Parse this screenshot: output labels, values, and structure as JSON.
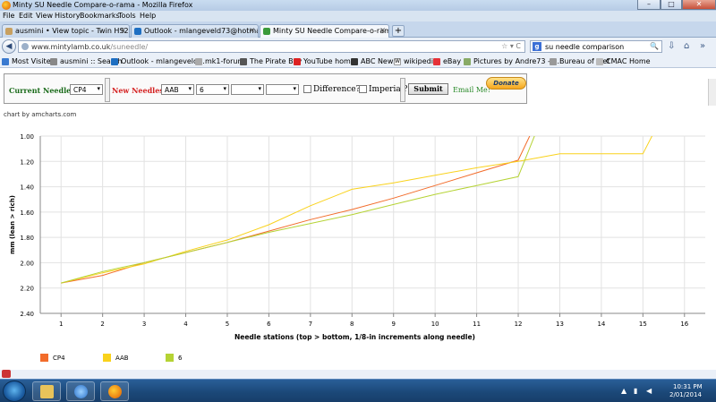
{
  "window": {
    "title": "Minty SU Needle Compare-o-rama - Mozilla Firefox",
    "minimize": "–",
    "maximize": "□",
    "close": "✕"
  },
  "menu": [
    "File",
    "Edit",
    "View",
    "History",
    "Bookmarks",
    "Tools",
    "Help"
  ],
  "tabs": [
    {
      "label": "ausmini • View topic - Twin HS2 1.5\" ...",
      "close": "×",
      "icon_color": "#c8a060"
    },
    {
      "label": "Outlook - mlangeveld73@hotmail.com",
      "close": "×",
      "icon_color": "#1e6fc2"
    },
    {
      "label": "Minty SU Needle Compare-o-rama",
      "close": "×",
      "icon_color": "#3a9a3a",
      "active": true
    }
  ],
  "new_tab": "+",
  "nav": {
    "back": "◀",
    "url_host": "www.mintylamb.co.uk",
    "url_path": "/suneedle/",
    "url_right": "☆ ▾ C",
    "search_engine": "g",
    "search_value": "su needle comparison",
    "search_btn": "🔍",
    "home_icon": "⌂"
  },
  "bookmarks": [
    {
      "label": "Most Visited",
      "color": "#3a7ad0"
    },
    {
      "label": "ausmini :: Search",
      "color": "#888"
    },
    {
      "label": "Outlook - mlangeveld...",
      "color": "#1e6fc2"
    },
    {
      "label": "mk1-forum",
      "color": "#aaa"
    },
    {
      "label": "The Pirate Bay",
      "color": "#555"
    },
    {
      "label": "YouTube home",
      "color": "#d22"
    },
    {
      "label": "ABC News",
      "color": "#333"
    },
    {
      "label": "wikipedia",
      "color": "#fff"
    },
    {
      "label": "eBay",
      "color": "#e53238"
    },
    {
      "label": "Pictures by Andre73 - ...",
      "color": "#8a6"
    },
    {
      "label": "Bureau of Met",
      "color": "#999"
    },
    {
      "label": "CMAC Home",
      "color": "#bbb"
    }
  ],
  "form": {
    "current_label": "Current Needle:",
    "current_value": "CP4",
    "new_label": "New Needles:",
    "new_1": "AAB",
    "new_2": "6",
    "new_3": "",
    "new_4": "",
    "difference_label": "Difference?",
    "imperial_label": "Imperial?",
    "submit_label": "Submit",
    "email_label": "Email Me!",
    "donate_label": "Donate",
    "dropdown_arrow": "▾",
    "current_label_color": "#1a6b1a",
    "new_label_color": "#d42020"
  },
  "chart_credit": "chart by amcharts.com",
  "chart_data": {
    "type": "line",
    "ylabel": "mm (lean > rich)",
    "xlabel": "Needle stations (top > bottom, 1/8-in increments along needle)",
    "ylim": [
      1.0,
      2.4
    ],
    "y_reversed": true,
    "y_ticks": [
      "1.00",
      "1.20",
      "1.40",
      "1.60",
      "1.80",
      "2.00",
      "2.20",
      "2.40"
    ],
    "x": [
      1,
      2,
      3,
      4,
      5,
      6,
      7,
      8,
      9,
      10,
      11,
      12,
      13,
      14,
      15,
      16
    ],
    "x_tick_labels": [
      "1",
      "2",
      "3",
      "4",
      "5",
      "6",
      "7",
      "8",
      "9",
      "10",
      "11",
      "12",
      "13",
      "14",
      "15",
      "16"
    ],
    "grid": true,
    "legend_position": "bottom-left",
    "series": [
      {
        "name": "CP4",
        "color": "#f26c2b",
        "values": [
          2.16,
          2.1,
          2.0,
          1.92,
          1.84,
          1.75,
          1.66,
          1.58,
          1.49,
          1.39,
          1.29,
          1.19,
          0.5,
          null,
          null,
          null
        ]
      },
      {
        "name": "AAB",
        "color": "#f9d21c",
        "values": [
          2.16,
          2.08,
          2.01,
          1.91,
          1.82,
          1.7,
          1.55,
          1.42,
          1.37,
          1.31,
          1.25,
          1.2,
          1.14,
          1.14,
          1.14,
          0.5
        ]
      },
      {
        "name": "6",
        "color": "#b5d334",
        "values": [
          2.16,
          2.07,
          2.0,
          1.92,
          1.84,
          1.76,
          1.69,
          1.62,
          1.54,
          1.46,
          1.39,
          1.32,
          0.5,
          null,
          null,
          null
        ]
      }
    ]
  },
  "taskbar": {
    "time": "10:31 PM",
    "date": "2/01/2014",
    "tray_up": "▲"
  }
}
